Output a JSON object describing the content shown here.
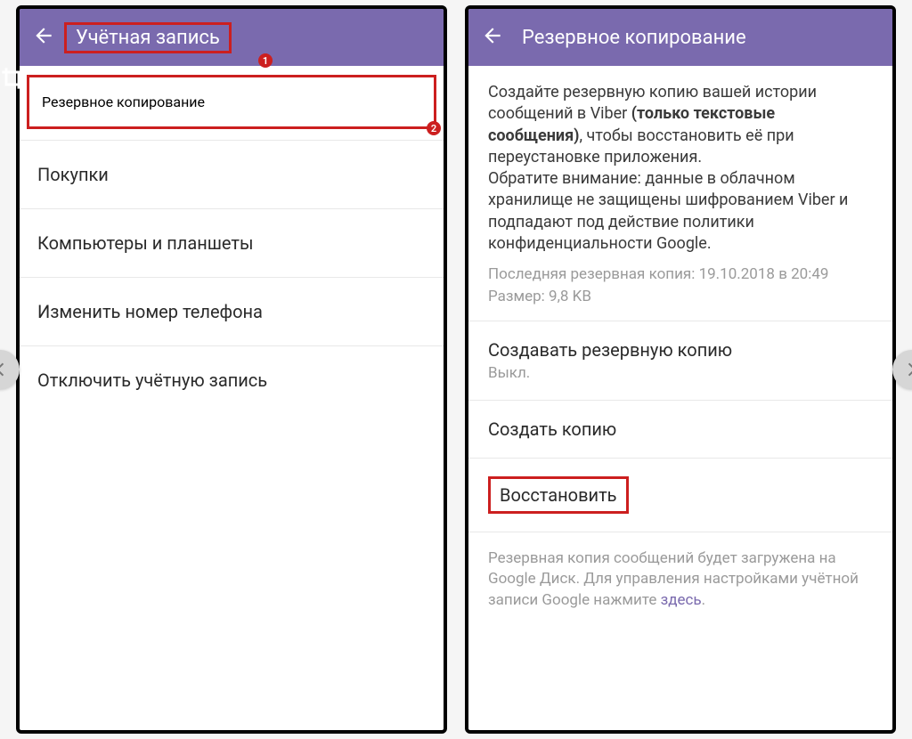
{
  "left": {
    "title": "Учётная запись",
    "items": [
      "Резервное копирование",
      "Покупки",
      "Компьютеры и планшеты",
      "Изменить номер телефона",
      "Отключить учётную запись"
    ],
    "badge1": "1",
    "badge2": "2"
  },
  "right": {
    "title": "Резервное копирование",
    "info_p1a": "Создайте резервную копию вашей истории сообщений в Viber ",
    "info_p1b": "(только текстовые сообщения)",
    "info_p1c": ", чтобы восстановить её при переустановке приложения.",
    "info_p2": "Обратите внимание: данные в облачном хранилище не защищены шифрованием Viber и подпадают под действие политики конфиденциальности Google.",
    "meta_last": "Последняя резервная копия: 19.10.2018 в 20:49",
    "meta_size": "Размер: 9,8 KB",
    "auto_label": "Создавать резервную копию",
    "auto_value": "Выкл.",
    "create_label": "Создать копию",
    "restore_label": "Восстановить",
    "footer_a": "Резервная копия сообщений будет загружена на Google Диск. Для управления настройками учётной записи Google нажмите ",
    "footer_link": "здесь",
    "footer_b": "."
  }
}
